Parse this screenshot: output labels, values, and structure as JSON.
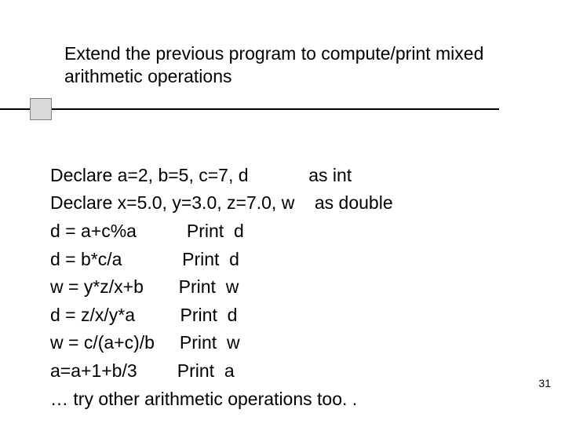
{
  "title": "Extend the previous program to compute/print mixed arithmetic  operations",
  "lines": {
    "l0": "Declare a=2, b=5, c=7, d            as int",
    "l1": "Declare x=5.0, y=3.0, z=7.0, w    as double",
    "l2": "d = a+c%a          Print  d",
    "l3": "d = b*c/a            Print  d",
    "l4": "w = y*z/x+b       Print  w",
    "l5": "d = z/x/y*a         Print  d",
    "l6": "w = c/(a+c)/b     Print  w",
    "l7": "a=a+1+b/3        Print  a",
    "l8": "… try other arithmetic operations too. ."
  },
  "page_number": "31"
}
